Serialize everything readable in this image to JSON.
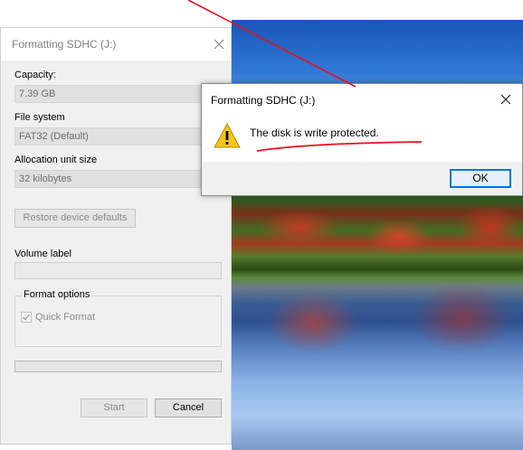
{
  "colors": {
    "accent": "#0078d7",
    "annotation": "#e8101e",
    "warning": "#f5c518"
  },
  "format_dialog": {
    "title": "Formatting SDHC (J:)",
    "close_icon": "close-icon",
    "capacity_label": "Capacity:",
    "capacity_value": "7.39 GB",
    "file_system_label": "File system",
    "file_system_value": "FAT32 (Default)",
    "allocation_label": "Allocation unit size",
    "allocation_value": "32 kilobytes",
    "restore_label": "Restore device defaults",
    "volume_label": "Volume label",
    "volume_value": "",
    "format_options_label": "Format options",
    "quick_format_label": "Quick Format",
    "quick_format_checked": true,
    "start_label": "Start",
    "cancel_label": "Cancel"
  },
  "message_box": {
    "title": "Formatting SDHC (J:)",
    "icon": "warning-icon",
    "message": "The disk is write protected.",
    "ok_label": "OK"
  }
}
